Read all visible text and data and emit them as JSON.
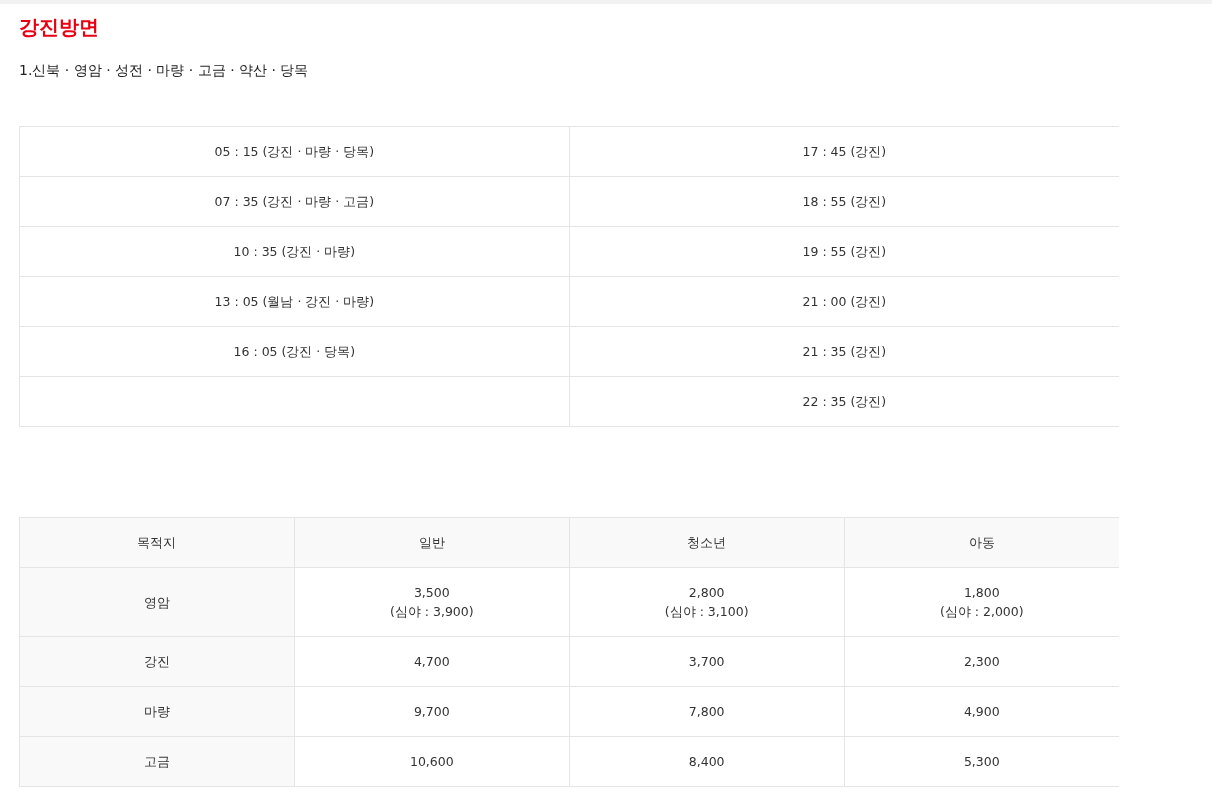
{
  "title": "강진방면",
  "route": "1.신북 · 영암 · 성전 · 마량 · 고금 · 약산 · 당목",
  "schedule": {
    "left": [
      "05 : 15 (강진 · 마량 · 당목)",
      "07 : 35 (강진 · 마량 · 고금)",
      "10 : 35 (강진 · 마량)",
      "13 : 05 (월남 · 강진 · 마량)",
      "16 : 05 (강진 · 당목)"
    ],
    "right": [
      "17 : 45 (강진)",
      "18 : 55 (강진)",
      "19 : 55 (강진)",
      "21 : 00 (강진)",
      "21 : 35 (강진)",
      "22 : 35 (강진)"
    ]
  },
  "fares": {
    "columns": [
      "목적지",
      "일반",
      "청소년",
      "아동"
    ],
    "rows": [
      {
        "cells": [
          [
            "영암"
          ],
          [
            "3,500",
            "(심야 : 3,900)"
          ],
          [
            "2,800",
            "(심야 : 3,100)"
          ],
          [
            "1,800",
            "(심야 : 2,000)"
          ]
        ]
      },
      {
        "cells": [
          [
            "강진"
          ],
          [
            "4,700"
          ],
          [
            "3,700"
          ],
          [
            "2,300"
          ]
        ]
      },
      {
        "cells": [
          [
            "마량"
          ],
          [
            "9,700"
          ],
          [
            "7,800"
          ],
          [
            "4,900"
          ]
        ]
      },
      {
        "cells": [
          [
            "고금"
          ],
          [
            "10,600"
          ],
          [
            "8,400"
          ],
          [
            "5,300"
          ]
        ]
      }
    ]
  }
}
